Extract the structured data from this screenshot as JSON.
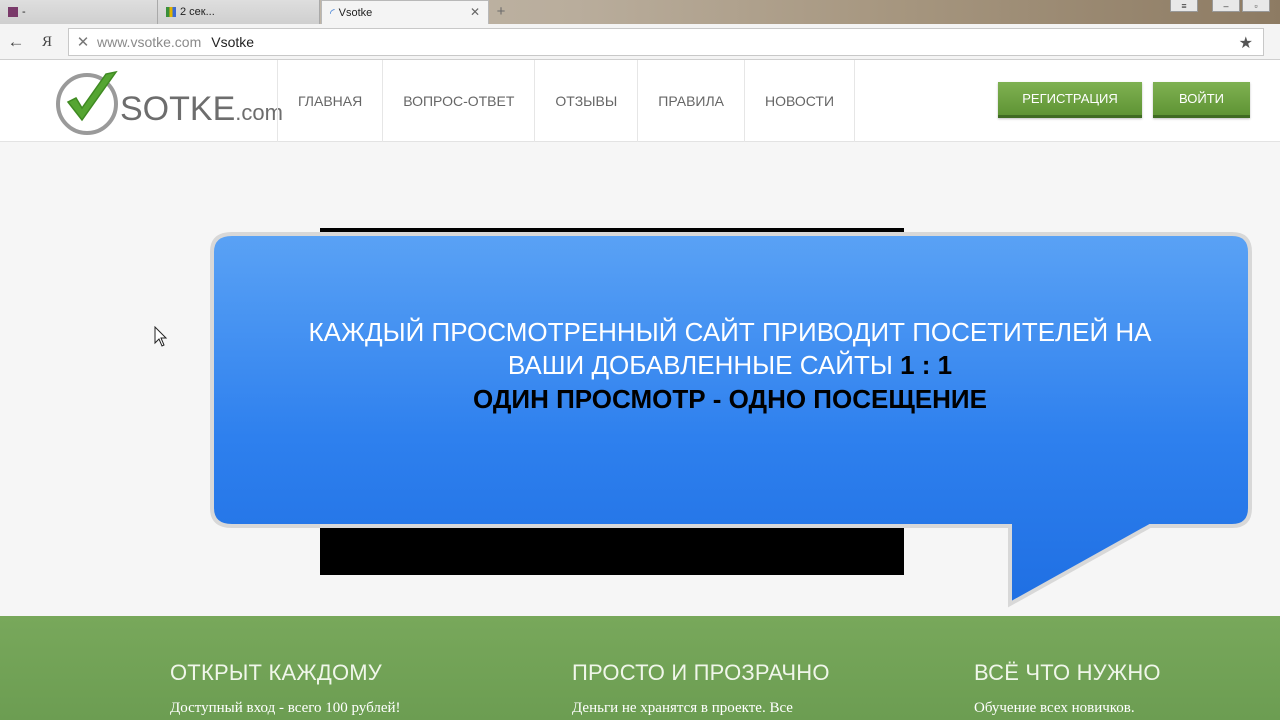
{
  "browser": {
    "tabs": [
      {
        "title": "-"
      },
      {
        "title": "2 сек..."
      },
      {
        "title": "Vsotke"
      }
    ],
    "address": {
      "host": "www.vsotke.com",
      "title": "Vsotke"
    },
    "yandex_label": "Я"
  },
  "site": {
    "logo": {
      "text": "SOTKE",
      "suffix": ".com"
    },
    "nav": [
      "ГЛАВНАЯ",
      "ВОПРОС-ОТВЕТ",
      "ОТЗЫВЫ",
      "ПРАВИЛА",
      "НОВОСТИ"
    ],
    "buttons": {
      "register": "РЕГИСТРАЦИЯ",
      "login": "ВОЙТИ"
    },
    "accent_color": "#6ea14a",
    "bubble_color": "#2f83ef"
  },
  "bubble": {
    "line1": "КАЖДЫЙ ПРОСМОТРЕННЫЙ САЙТ ПРИВОДИТ ПОСЕТИТЕЛЕЙ НА",
    "line2": "ВАШИ  ДОБАВЛЕННЫЕ САЙТЫ",
    "ratio": "1 : 1",
    "line3": "ОДИН ПРОСМОТР - ОДНО ПОСЕЩЕНИЕ"
  },
  "features": [
    {
      "title": "ОТКРЫТ КАЖДОМУ",
      "text": "Доступный вход - всего 100 рублей!"
    },
    {
      "title": "ПРОСТО И ПРОЗРАЧНО",
      "text": "Деньги не хранятся в проекте. Все"
    },
    {
      "title": "ВСЁ ЧТО НУЖНО",
      "text": "Обучение всех новичков."
    }
  ]
}
